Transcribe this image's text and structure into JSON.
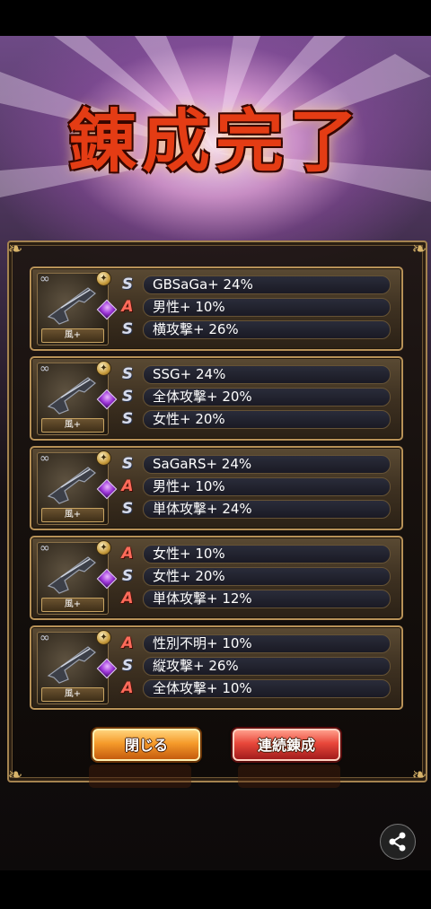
{
  "title": "錬成完了",
  "cards": [
    {
      "element": "風+",
      "rows": [
        {
          "rank": "S",
          "text": "GBSaGa+ 24%"
        },
        {
          "rank": "A",
          "text": "男性+ 10%"
        },
        {
          "rank": "S",
          "text": "横攻撃+ 26%"
        }
      ]
    },
    {
      "element": "風+",
      "rows": [
        {
          "rank": "S",
          "text": "SSG+ 24%"
        },
        {
          "rank": "S",
          "text": "全体攻撃+ 20%"
        },
        {
          "rank": "S",
          "text": "女性+ 20%"
        }
      ]
    },
    {
      "element": "風+",
      "rows": [
        {
          "rank": "S",
          "text": "SaGaRS+ 24%"
        },
        {
          "rank": "A",
          "text": "男性+ 10%"
        },
        {
          "rank": "S",
          "text": "単体攻撃+ 24%"
        }
      ]
    },
    {
      "element": "風+",
      "rows": [
        {
          "rank": "A",
          "text": "女性+ 10%"
        },
        {
          "rank": "S",
          "text": "女性+ 20%"
        },
        {
          "rank": "A",
          "text": "単体攻撃+ 12%"
        }
      ]
    },
    {
      "element": "風+",
      "rows": [
        {
          "rank": "A",
          "text": "性別不明+ 10%"
        },
        {
          "rank": "S",
          "text": "縦攻撃+ 26%"
        },
        {
          "rank": "A",
          "text": "全体攻撃+ 10%"
        }
      ]
    }
  ],
  "buttons": {
    "close": "閉じる",
    "continue": "連続錬成"
  },
  "icons": {
    "share": "share-icon",
    "weapon": "gun-icon",
    "gem": "purple-gem-icon",
    "coin": "gold-coin-icon"
  },
  "colors": {
    "rank_s": "#d7dcec",
    "rank_a": "#ff6b5a",
    "title": "#e43c14",
    "close_button": "#f59a2a",
    "continue_button": "#e8473a"
  }
}
